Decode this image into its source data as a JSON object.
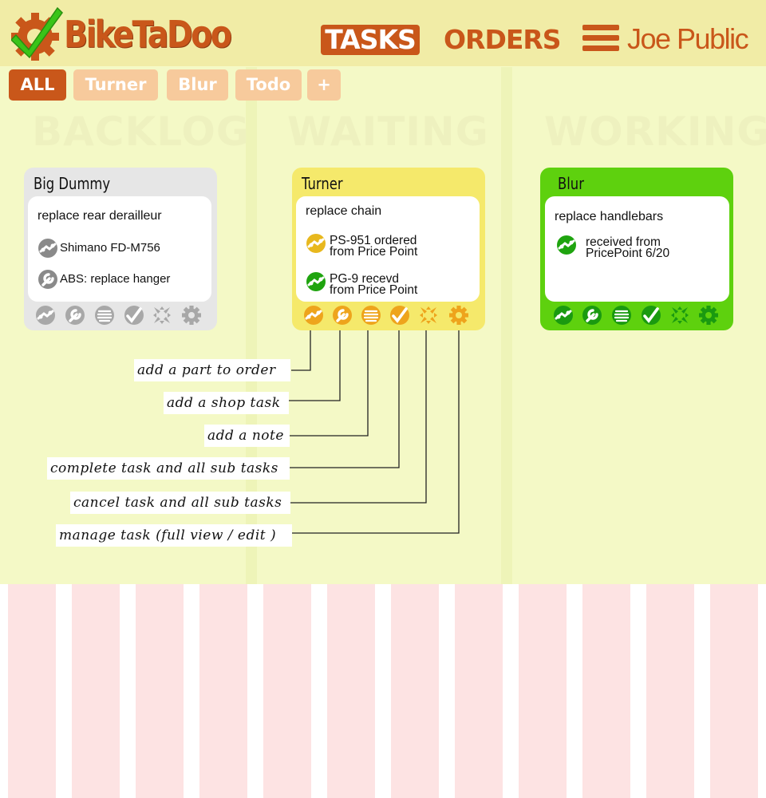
{
  "app": {
    "logo_text": "BikeTaDoo",
    "nav": {
      "tasks": "TASKS",
      "orders": "ORDERS"
    },
    "user_name": "Joe Public"
  },
  "filters": [
    {
      "label": "ALL",
      "active": true
    },
    {
      "label": "Turner",
      "active": false
    },
    {
      "label": "Blur",
      "active": false
    },
    {
      "label": "Todo",
      "active": false
    },
    {
      "label": "+",
      "active": false
    }
  ],
  "columns": [
    {
      "title": "BACKLOG"
    },
    {
      "title": "WAITING"
    },
    {
      "title": "WORKING"
    }
  ],
  "cards": [
    {
      "title": "Big Dummy",
      "task": "replace rear derailleur",
      "subtasks": [
        {
          "line1": "Shimano FD-M756",
          "line2": "",
          "icon": "wrench-icon"
        },
        {
          "line1": "ABS: replace hanger",
          "line2": "",
          "icon": "wrench-icon"
        }
      ]
    },
    {
      "title": "Turner",
      "task": "replace chain",
      "subtasks": [
        {
          "line1": "PS-951 ordered",
          "line2": "from Price Point",
          "icon": "part-icon"
        },
        {
          "line1": "PG-9 recevd",
          "line2": "from Price Point",
          "icon": "part-icon"
        }
      ]
    },
    {
      "title": "Blur",
      "task": "replace handlebars",
      "subtasks": [
        {
          "line1": "received from",
          "line2": "PricePoint 6/20",
          "icon": "part-icon"
        }
      ]
    }
  ],
  "toolbar_icons": [
    "add-part-icon",
    "add-shop-task-icon",
    "add-note-icon",
    "complete-icon",
    "cancel-icon",
    "manage-icon"
  ],
  "callouts": [
    "add a part to order",
    "add a shop task",
    "add a note",
    "complete task and all sub tasks",
    "cancel task and all sub tasks",
    "manage task (full view / edit )"
  ],
  "colors": {
    "brand": "#c9571a",
    "backlog_card": "#e6e6e6",
    "waiting_card": "#f5e96b",
    "working_card": "#5ed10e",
    "check_green": "#3ac419"
  }
}
